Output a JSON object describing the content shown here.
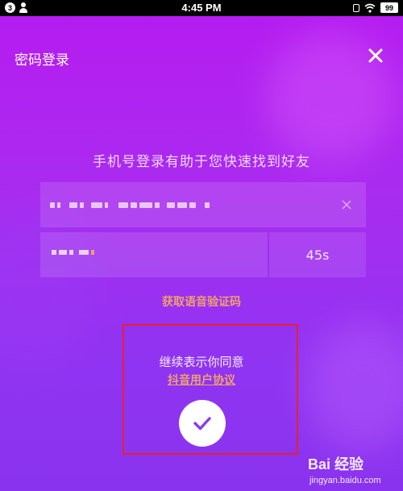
{
  "status_bar": {
    "notification_count": "3",
    "time": "4:45 PM",
    "battery": "99"
  },
  "header": {
    "title": "密码登录",
    "close_icon": "close-icon"
  },
  "subtitle": "手机号登录有助于您快速找到好友",
  "phone_field": {
    "value_state": "obscured",
    "clear_icon": "clear-icon"
  },
  "code_field": {
    "value_state": "obscured",
    "countdown": "45s"
  },
  "voice_code_link": "获取语音验证码",
  "agreement": {
    "prompt": "继续表示你同意",
    "link": "抖音用户协议",
    "confirm_icon": "checkmark-icon"
  },
  "watermark": {
    "logo": "Bai 经验",
    "url": "jingyan.baidu.com"
  },
  "colors": {
    "gradient_top": "#b61bf0",
    "gradient_bottom": "#8a33ee",
    "link_orange": "#f0a06e",
    "highlight_red": "#e5222e",
    "check_purple": "#8b3bf2"
  }
}
